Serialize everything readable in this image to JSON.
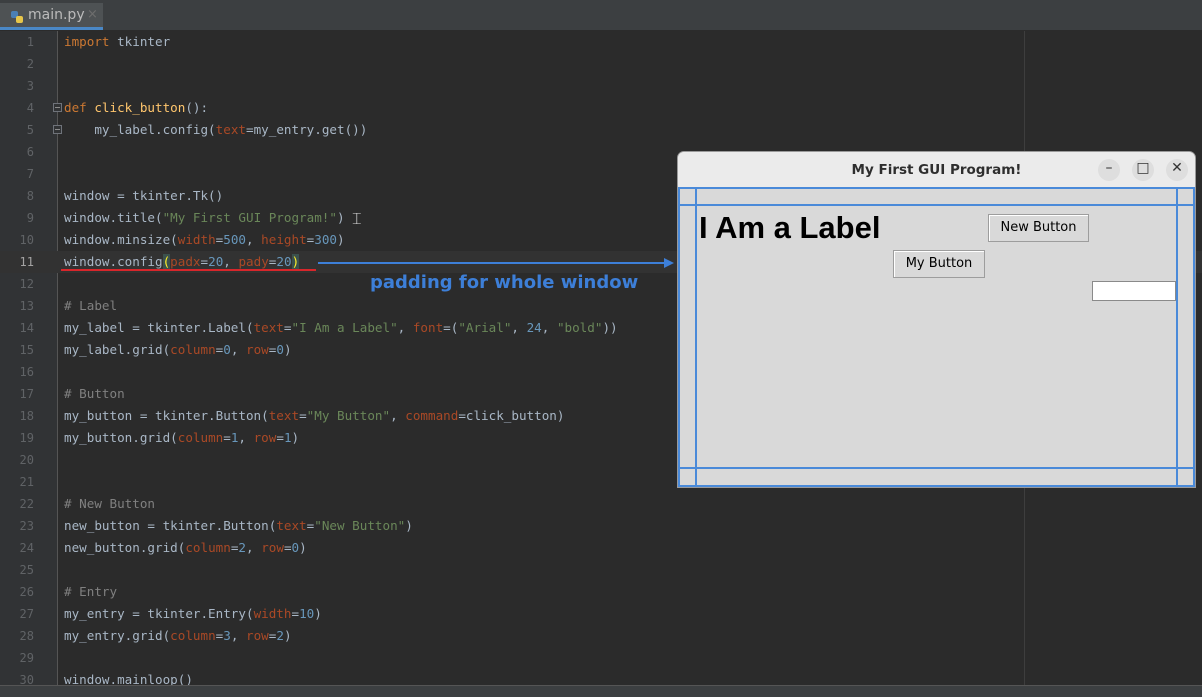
{
  "editor": {
    "tab": {
      "filename": "main.py",
      "close_glyph": "×",
      "icon": "python-file-icon"
    },
    "current_line": 11,
    "lines": [
      {
        "n": "1"
      },
      {
        "n": "2"
      },
      {
        "n": "3"
      },
      {
        "n": "4"
      },
      {
        "n": "5"
      },
      {
        "n": "6"
      },
      {
        "n": "7"
      },
      {
        "n": "8"
      },
      {
        "n": "9"
      },
      {
        "n": "10"
      },
      {
        "n": "11"
      },
      {
        "n": "12"
      },
      {
        "n": "13"
      },
      {
        "n": "14"
      },
      {
        "n": "15"
      },
      {
        "n": "16"
      },
      {
        "n": "17"
      },
      {
        "n": "18"
      },
      {
        "n": "19"
      },
      {
        "n": "20"
      },
      {
        "n": "21"
      },
      {
        "n": "22"
      },
      {
        "n": "23"
      },
      {
        "n": "24"
      },
      {
        "n": "25"
      },
      {
        "n": "26"
      },
      {
        "n": "27"
      },
      {
        "n": "28"
      },
      {
        "n": "29"
      },
      {
        "n": "30"
      }
    ],
    "code": {
      "l1": [
        "import",
        " tkinter"
      ],
      "l4": [
        "def",
        " ",
        "click_button",
        "():"
      ],
      "l5": [
        "    my_label.config(",
        "text",
        "=my_entry.get())"
      ],
      "l8": [
        "window = tkinter.Tk()"
      ],
      "l9": [
        "window.title(",
        "\"My First GUI Program!\"",
        ")"
      ],
      "l10": [
        "window.minsize(",
        "width",
        "=",
        "500",
        ", ",
        "height",
        "=",
        "300",
        ")"
      ],
      "l11": [
        "window.config",
        "(",
        "padx",
        "=",
        "20",
        ", ",
        "pady",
        "=",
        "20",
        ")"
      ],
      "l13": [
        "# Label"
      ],
      "l14": [
        "my_label = tkinter.Label(",
        "text",
        "=",
        "\"I Am a Label\"",
        ", ",
        "font",
        "=(",
        "\"Arial\"",
        ", ",
        "24",
        ", ",
        "\"bold\"",
        "))"
      ],
      "l15": [
        "my_label.grid(",
        "column",
        "=",
        "0",
        ", ",
        "row",
        "=",
        "0",
        ")"
      ],
      "l17": [
        "# Button"
      ],
      "l18": [
        "my_button = tkinter.Button(",
        "text",
        "=",
        "\"My Button\"",
        ", ",
        "command",
        "=click_button)"
      ],
      "l19": [
        "my_button.grid(",
        "column",
        "=",
        "1",
        ", ",
        "row",
        "=",
        "1",
        ")"
      ],
      "l22": [
        "# New Button"
      ],
      "l23": [
        "new_button = tkinter.Button(",
        "text",
        "=",
        "\"New Button\"",
        ")"
      ],
      "l24": [
        "new_button.grid(",
        "column",
        "=",
        "2",
        ", ",
        "row",
        "=",
        "0",
        ")"
      ],
      "l26": [
        "# Entry"
      ],
      "l27": [
        "my_entry = tkinter.Entry(",
        "width",
        "=",
        "10",
        ")"
      ],
      "l28": [
        "my_entry.grid(",
        "column",
        "=",
        "3",
        ", ",
        "row",
        "=",
        "2",
        ")"
      ],
      "l30": [
        "window.mainloop()"
      ]
    }
  },
  "annotation": {
    "text": "padding for whole window",
    "arrow_color": "#3d7fd8",
    "underline_color": "#d8262b"
  },
  "gui_window": {
    "title": "My First GUI Program!",
    "controls": {
      "minimize": "–",
      "maximize": "□",
      "close": "✕"
    },
    "label_text": "I Am a Label",
    "new_button": "New Button",
    "my_button": "My Button",
    "entry_value": "",
    "padding_outline_color": "#4a8ad9"
  },
  "colors": {
    "editor_bg": "#2b2b2b",
    "keyword": "#cc7832",
    "string": "#6a8759",
    "number": "#6897bb",
    "function": "#ffc66d",
    "param": "#aa4926",
    "comment": "#808080"
  }
}
